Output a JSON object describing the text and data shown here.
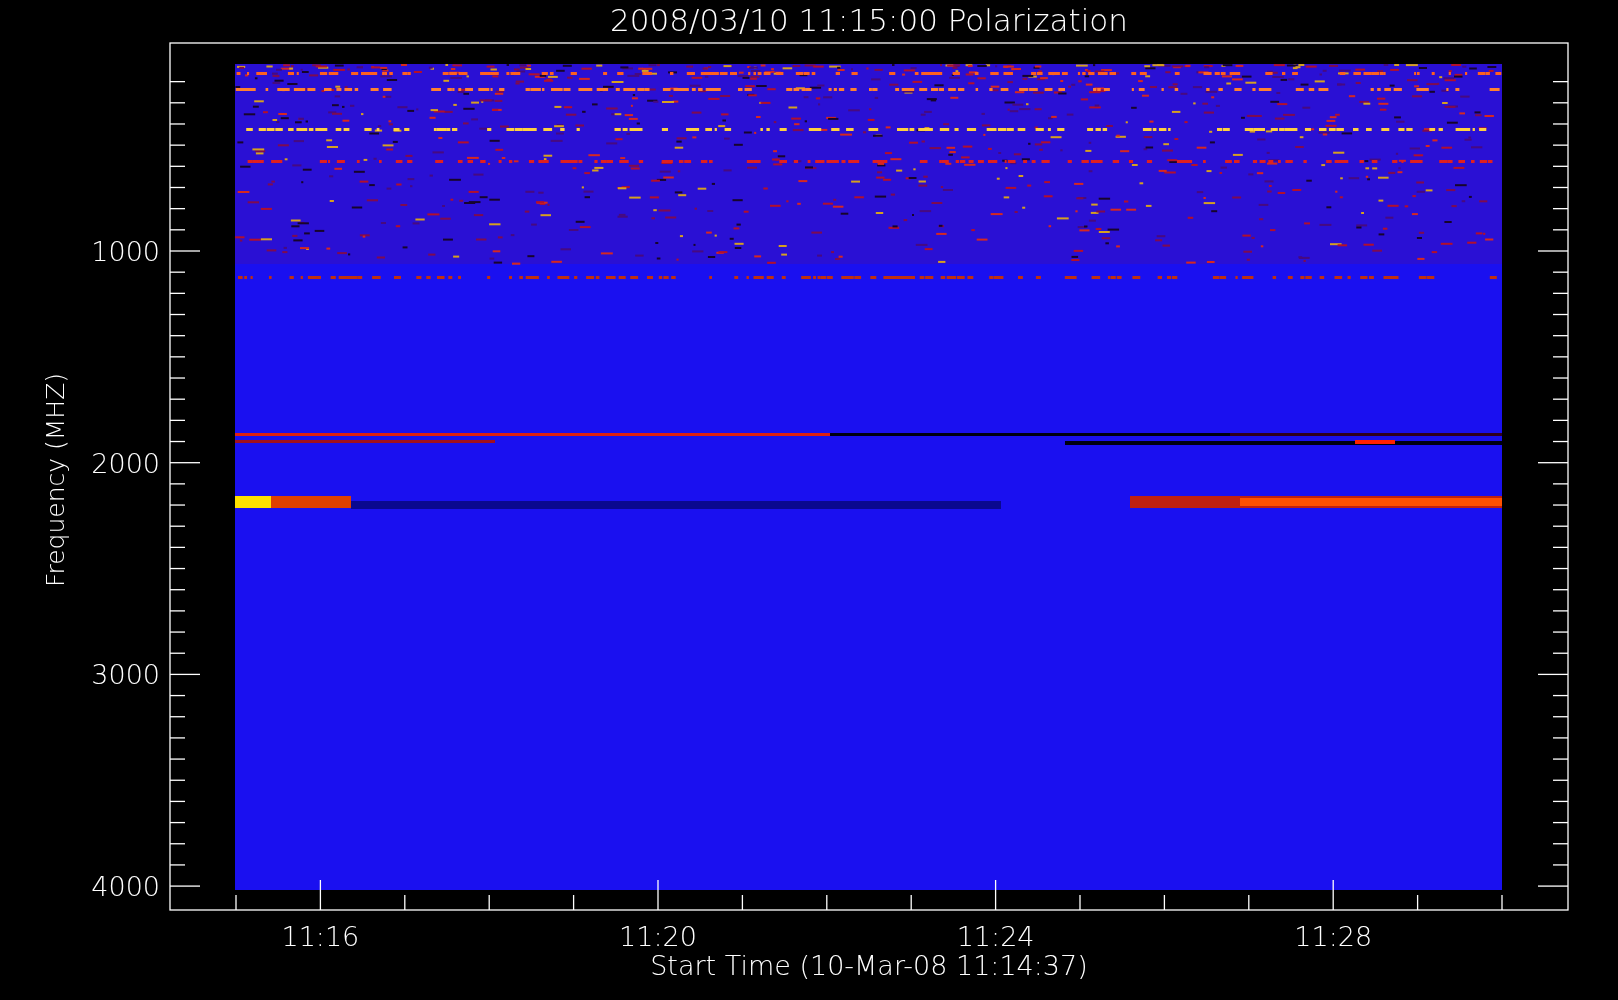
{
  "title": "2008/03/10 11:15:00 Polarization",
  "y_axis": {
    "label": "Frequency (MHZ)",
    "ticks": [
      "1000",
      "2000",
      "3000",
      "4000"
    ]
  },
  "x_axis": {
    "label": "Start Time (10-Mar-08 11:14:37)",
    "ticks": [
      "11:16",
      "11:20",
      "11:24",
      "11:28"
    ]
  }
}
